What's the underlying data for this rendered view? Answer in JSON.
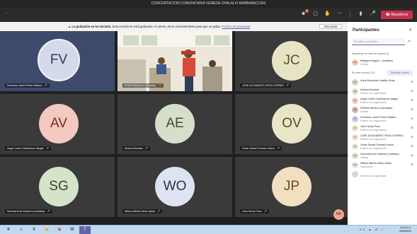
{
  "window": {
    "title": "CONCERTACION COMUNITARIA VEREDA CHALALVI BARBABACOAS",
    "timer": "···"
  },
  "toolbar": {
    "icons": [
      "participants-icon",
      "chat-icon",
      "raise-hand-icon",
      "more-options-icon",
      "camera-icon",
      "mic-icon",
      "share-icon"
    ],
    "badge_count": "1",
    "leave_label": "Abandonar"
  },
  "banner": {
    "bold": "La grabación se ha iniciado.",
    "text": "Esta reunión se está grabando. Al unirse, da su consentimiento para que se grabe.",
    "link": "Política de privacidad",
    "dismiss": "Descartar"
  },
  "tiles": [
    {
      "initials": "FV",
      "name": "Francisco Javier Peña Velasco",
      "color": "#3d4a6b",
      "avatar_bg": "#d5d9ec",
      "avatar_fg": "#2e3b5e",
      "video": false
    },
    {
      "initials": "",
      "name": "FEDER ANGULO (Invitado)",
      "color": "#e9e4d6",
      "avatar_bg": "",
      "avatar_fg": "",
      "video": true
    },
    {
      "initials": "JC",
      "name": "JOSE ALEJANDRO VEGA CORREA",
      "color": "#3a3a3a",
      "avatar_bg": "#e7e4c6",
      "avatar_fg": "#58502a",
      "video": false
    },
    {
      "initials": "AV",
      "name": "Angie Lizeth Castellanos Vargas",
      "color": "#3a3a3a",
      "avatar_bg": "#f4c9bf",
      "avatar_fg": "#7a2b1d",
      "video": false
    },
    {
      "initials": "AE",
      "name": "Andrea Escobar",
      "color": "#3a3a3a",
      "avatar_bg": "#d6dfc9",
      "avatar_fg": "#3f4d30",
      "video": false
    },
    {
      "initials": "OV",
      "name": "Oscar Daniel Fuentes Vivero",
      "color": "#3a3a3a",
      "avatar_bg": "#e8e6c6",
      "avatar_fg": "#4f4e24",
      "video": false
    },
    {
      "initials": "SG",
      "name": "Secretaría de Gobierno (Invitado)",
      "color": "#3a3a3a",
      "avatar_bg": "#d5e3c8",
      "avatar_fg": "#34482a",
      "video": false
    },
    {
      "initials": "WO",
      "name": "Wilson Alberto Mera Ojeda",
      "color": "#3a3a3a",
      "avatar_bg": "#dde3f0",
      "avatar_fg": "#27345a",
      "video": false
    },
    {
      "initials": "JP",
      "name": "Jhon Henry Pozo",
      "color": "#3a3a3a",
      "avatar_bg": "#f1dfbf",
      "avatar_fg": "#6a4a1c",
      "video": false
    }
  ],
  "self_avatar": "MA",
  "participants": {
    "title": "Participantes",
    "invite_placeholder": "Escribir un nombre",
    "waiting_label": "Esperando en sala de espera (1)",
    "waiting": [
      {
        "initials": "MA",
        "name": "Margaret Angulo - (Invitado)",
        "sub": "Invitado",
        "bg": "#f5c6b8"
      }
    ],
    "in_meeting_label": "En esta reunión (12)",
    "admit_all": "Silenciar a todos",
    "in_meeting": [
      {
        "initials": "AC",
        "name": "Anny Mercedes Castillo Vivas",
        "sub": "",
        "bg": "#d9d2c5"
      },
      {
        "initials": "AE",
        "name": "Andrea Escobar",
        "sub": "Externo a su organización",
        "bg": "#d6dfc9"
      },
      {
        "initials": "AV",
        "name": "Angie Lizeth Castellanos Vargas",
        "sub": "Externo a su organización",
        "bg": "#f4c9bf"
      },
      {
        "initials": "FA",
        "name": "FEDER ANGULO (Invitado)",
        "sub": "Invitado",
        "bg": "#cbb79e"
      },
      {
        "initials": "FV",
        "name": "Francisco Javier Peña Velasco",
        "sub": "Externo a su organización",
        "bg": "#c7cde4"
      },
      {
        "initials": "JP",
        "name": "Jhon Henry Pozo",
        "sub": "Externo a su organización",
        "bg": "#f1dfbf"
      },
      {
        "initials": "JC",
        "name": "JOSE ALEJANDRO VEGA CORREA",
        "sub": "Externo a su organización",
        "bg": "#e7e4c6"
      },
      {
        "initials": "OV",
        "name": "Oscar Daniel Fuentes Vivero",
        "sub": "Externo a su organización",
        "bg": "#e8e6c6"
      },
      {
        "initials": "SG",
        "name": "Secretaría de Gobierno (Invitado)",
        "sub": "Invitado",
        "bg": "#d5e3c8"
      },
      {
        "initials": "WO",
        "name": "Wilson Alberto Mera Ojeda",
        "sub": "Organizador",
        "bg": "#dde3f0"
      },
      {
        "initials": "",
        "name": "",
        "sub": "Externo a su organización",
        "bg": "#d8d8d8"
      }
    ]
  },
  "taskbar": {
    "apps": [
      "start-icon",
      "ie-icon",
      "excel-icon",
      "explorer-icon",
      "chrome-icon",
      "word-icon",
      "teams-icon"
    ],
    "language": "ES",
    "time": "10:21 a.m.",
    "date": "26/06/2020"
  }
}
